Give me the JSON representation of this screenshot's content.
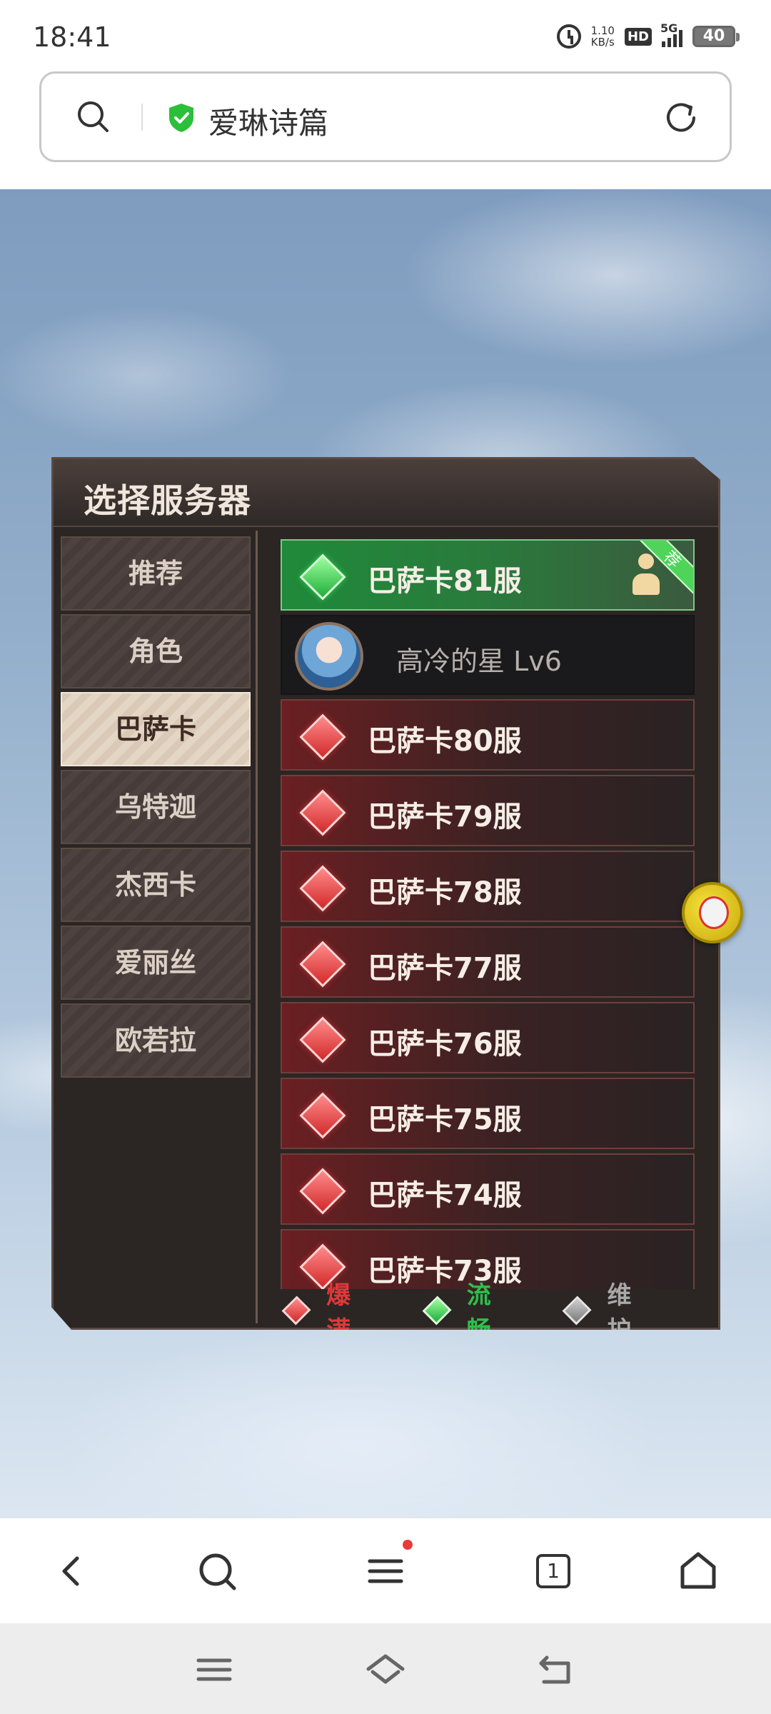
{
  "status_bar": {
    "time": "18:41",
    "net_speed_value": "1.10",
    "net_speed_unit": "KB/s",
    "hd_label": "HD",
    "signal_label": "5G",
    "battery": "40",
    "icons": [
      "alarm-icon",
      "hd-icon",
      "signal-icon",
      "battery-icon"
    ]
  },
  "address_bar": {
    "title": "爱琳诗篇",
    "icons": [
      "search-icon",
      "shield-check-icon",
      "refresh-icon"
    ],
    "shield_color": "#2bbf3a"
  },
  "game": {
    "panel_title": "选择服务器",
    "tabs": [
      {
        "label": "推荐",
        "active": false
      },
      {
        "label": "角色",
        "active": false
      },
      {
        "label": "巴萨卡",
        "active": true
      },
      {
        "label": "乌特迦",
        "active": false
      },
      {
        "label": "杰西卡",
        "active": false
      },
      {
        "label": "爱丽丝",
        "active": false
      },
      {
        "label": "欧若拉",
        "active": false
      }
    ],
    "recommended_server": {
      "name": "巴萨卡81服",
      "status": "流畅",
      "ribbon": "荐"
    },
    "character": {
      "name": "高冷的星 Lv6"
    },
    "servers": [
      {
        "name": "巴萨卡80服",
        "status": "爆满"
      },
      {
        "name": "巴萨卡79服",
        "status": "爆满"
      },
      {
        "name": "巴萨卡78服",
        "status": "爆满"
      },
      {
        "name": "巴萨卡77服",
        "status": "爆满"
      },
      {
        "name": "巴萨卡76服",
        "status": "爆满"
      },
      {
        "name": "巴萨卡75服",
        "status": "爆满"
      },
      {
        "name": "巴萨卡74服",
        "status": "爆满"
      },
      {
        "name": "巴萨卡73服",
        "status": "爆满"
      }
    ],
    "legend": [
      {
        "label": "爆满",
        "color": "#e0393a"
      },
      {
        "label": "流畅",
        "color": "#2fbf4a"
      },
      {
        "label": "维护",
        "color": "#a8a8a8"
      }
    ]
  },
  "browser_nav": {
    "tab_count": "1",
    "icons": [
      "back-icon",
      "search-icon",
      "menu-icon",
      "tabs-icon",
      "home-icon"
    ]
  },
  "system_nav": {
    "icons": [
      "menu-icon",
      "home-icon",
      "back-icon"
    ]
  }
}
